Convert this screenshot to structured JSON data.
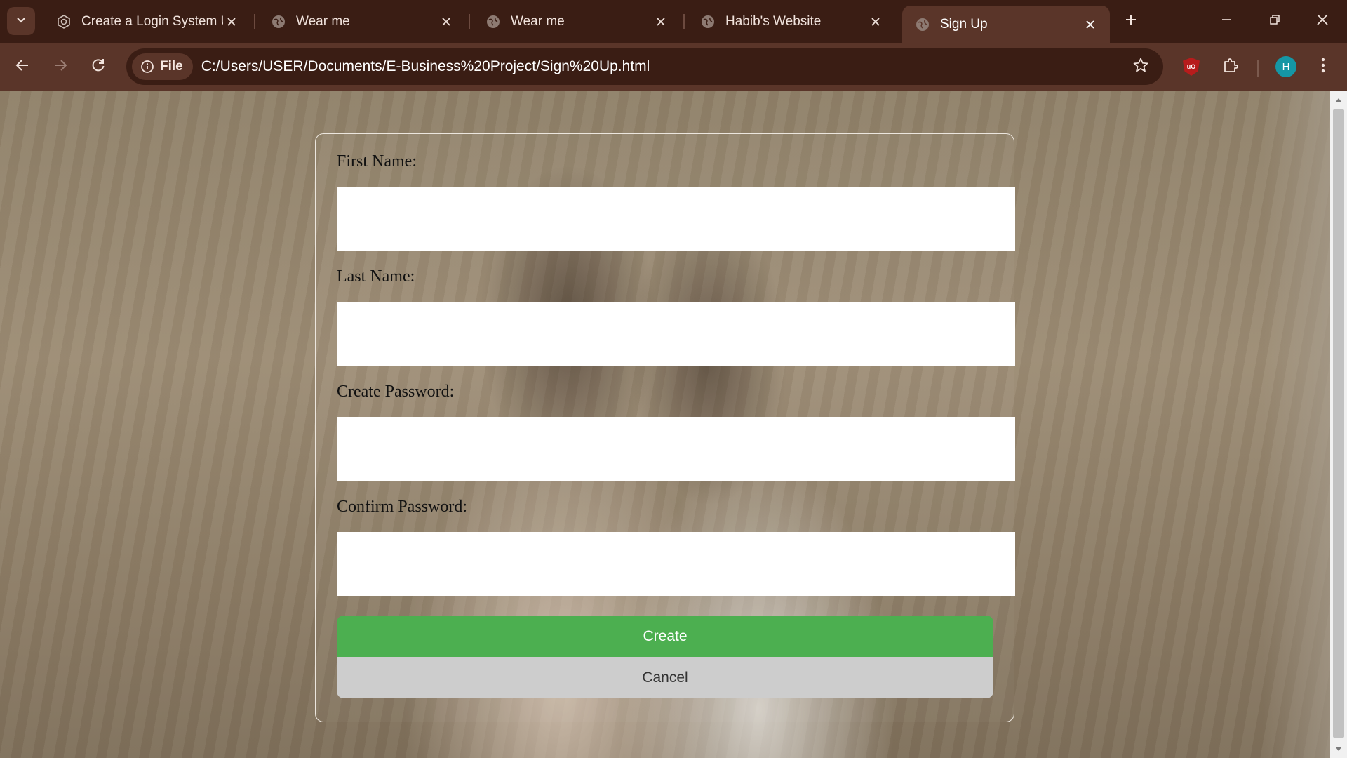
{
  "browser": {
    "tabs": [
      {
        "title": "Create a Login System Us",
        "icon": "app-icon",
        "active": false
      },
      {
        "title": "Wear me",
        "icon": "globe-icon",
        "active": false
      },
      {
        "title": "Wear me",
        "icon": "globe-icon",
        "active": false
      },
      {
        "title": "Habib's Website",
        "icon": "globe-icon",
        "active": false
      },
      {
        "title": "Sign Up",
        "icon": "globe-icon",
        "active": true
      }
    ],
    "address": {
      "chip_label": "File",
      "url": "C:/Users/USER/Documents/E-Business%20Project/Sign%20Up.html"
    },
    "profile_initial": "H",
    "ublock_label": "uO",
    "colors": {
      "frame": "#3a1d14",
      "toolbar": "#5a3529",
      "avatar": "#1597a5"
    }
  },
  "form": {
    "first_name_label": "First Name:",
    "last_name_label": "Last Name:",
    "create_password_label": "Create Password:",
    "confirm_password_label": "Confirm Password:",
    "first_name_value": "",
    "last_name_value": "",
    "create_password_value": "",
    "confirm_password_value": "",
    "create_label": "Create",
    "cancel_label": "Cancel",
    "colors": {
      "create_bg": "#4caf50",
      "cancel_bg": "#cdcdcd"
    }
  }
}
